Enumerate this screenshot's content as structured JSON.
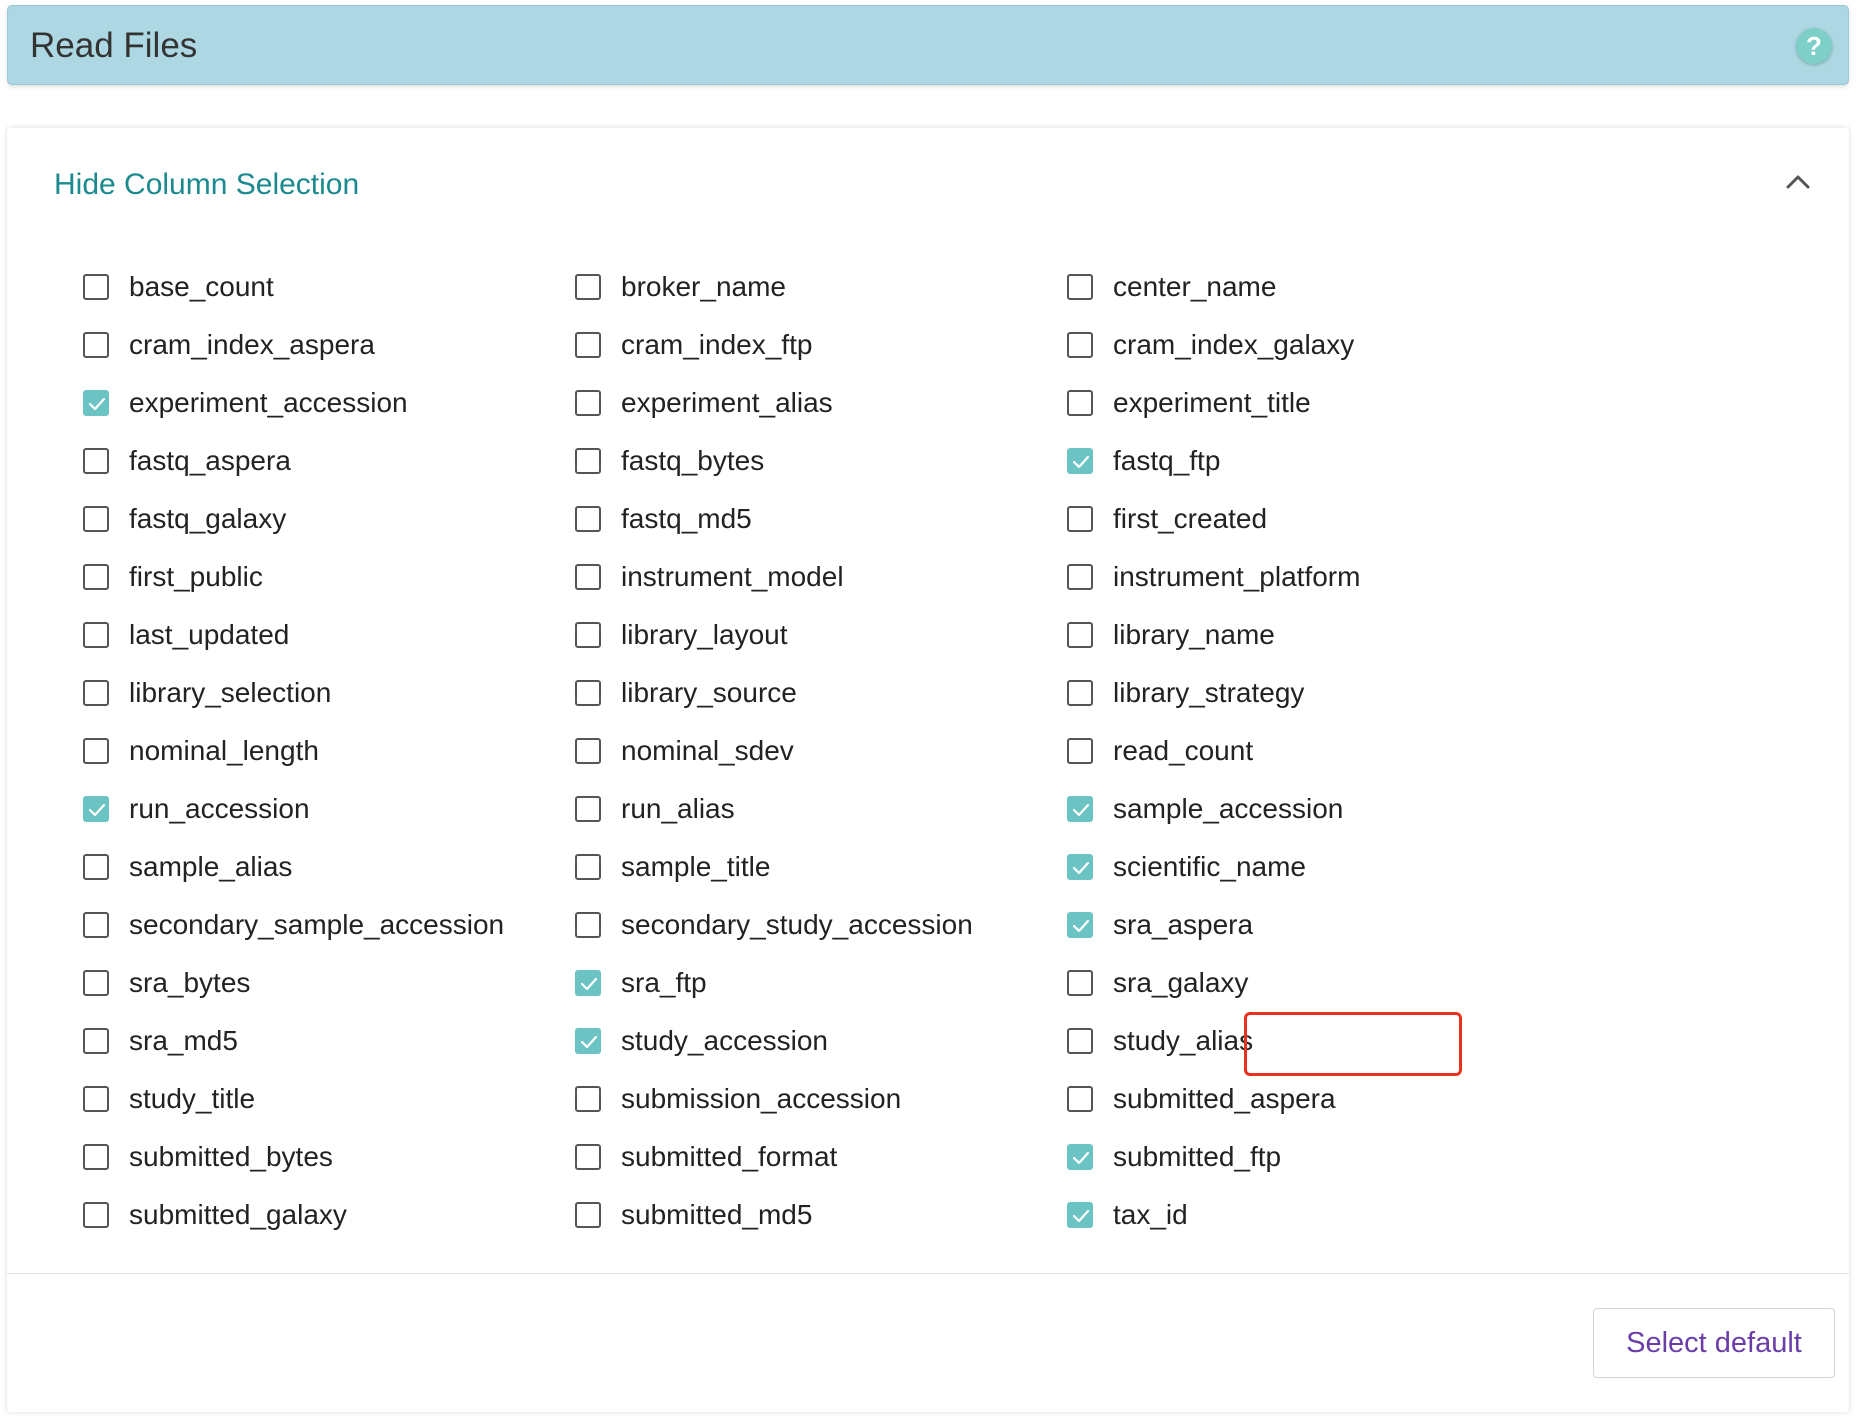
{
  "header": {
    "title": "Read Files",
    "help_label": "?"
  },
  "panel": {
    "toggle_label": "Hide Column Selection",
    "select_default_label": "Select default"
  },
  "columns": [
    [
      {
        "label": "base_count",
        "checked": false
      },
      {
        "label": "cram_index_aspera",
        "checked": false
      },
      {
        "label": "experiment_accession",
        "checked": true
      },
      {
        "label": "fastq_aspera",
        "checked": false
      },
      {
        "label": "fastq_galaxy",
        "checked": false
      },
      {
        "label": "first_public",
        "checked": false
      },
      {
        "label": "last_updated",
        "checked": false
      },
      {
        "label": "library_selection",
        "checked": false
      },
      {
        "label": "nominal_length",
        "checked": false
      },
      {
        "label": "run_accession",
        "checked": true
      },
      {
        "label": "sample_alias",
        "checked": false
      },
      {
        "label": "secondary_sample_accession",
        "checked": false
      },
      {
        "label": "sra_bytes",
        "checked": false
      },
      {
        "label": "sra_md5",
        "checked": false
      },
      {
        "label": "study_title",
        "checked": false
      },
      {
        "label": "submitted_bytes",
        "checked": false
      },
      {
        "label": "submitted_galaxy",
        "checked": false
      }
    ],
    [
      {
        "label": "broker_name",
        "checked": false
      },
      {
        "label": "cram_index_ftp",
        "checked": false
      },
      {
        "label": "experiment_alias",
        "checked": false
      },
      {
        "label": "fastq_bytes",
        "checked": false
      },
      {
        "label": "fastq_md5",
        "checked": false
      },
      {
        "label": "instrument_model",
        "checked": false
      },
      {
        "label": "library_layout",
        "checked": false
      },
      {
        "label": "library_source",
        "checked": false
      },
      {
        "label": "nominal_sdev",
        "checked": false
      },
      {
        "label": "run_alias",
        "checked": false
      },
      {
        "label": "sample_title",
        "checked": false
      },
      {
        "label": "secondary_study_accession",
        "checked": false
      },
      {
        "label": "sra_ftp",
        "checked": true
      },
      {
        "label": "study_accession",
        "checked": true
      },
      {
        "label": "submission_accession",
        "checked": false
      },
      {
        "label": "submitted_format",
        "checked": false
      },
      {
        "label": "submitted_md5",
        "checked": false
      }
    ],
    [
      {
        "label": "center_name",
        "checked": false
      },
      {
        "label": "cram_index_galaxy",
        "checked": false
      },
      {
        "label": "experiment_title",
        "checked": false
      },
      {
        "label": "fastq_ftp",
        "checked": true
      },
      {
        "label": "first_created",
        "checked": false
      },
      {
        "label": "instrument_platform",
        "checked": false
      },
      {
        "label": "library_name",
        "checked": false
      },
      {
        "label": "library_strategy",
        "checked": false
      },
      {
        "label": "read_count",
        "checked": false
      },
      {
        "label": "sample_accession",
        "checked": true
      },
      {
        "label": "scientific_name",
        "checked": true
      },
      {
        "label": "sra_aspera",
        "checked": true,
        "highlighted": true
      },
      {
        "label": "sra_galaxy",
        "checked": false
      },
      {
        "label": "study_alias",
        "checked": false
      },
      {
        "label": "submitted_aspera",
        "checked": false
      },
      {
        "label": "submitted_ftp",
        "checked": true
      },
      {
        "label": "tax_id",
        "checked": true
      }
    ]
  ],
  "colors": {
    "header_bg": "#add8e3",
    "checked": "#6cc3c3",
    "toggle_link": "#1b8a8f",
    "select_default": "#6a3ea8",
    "highlight": "#e8321f"
  }
}
